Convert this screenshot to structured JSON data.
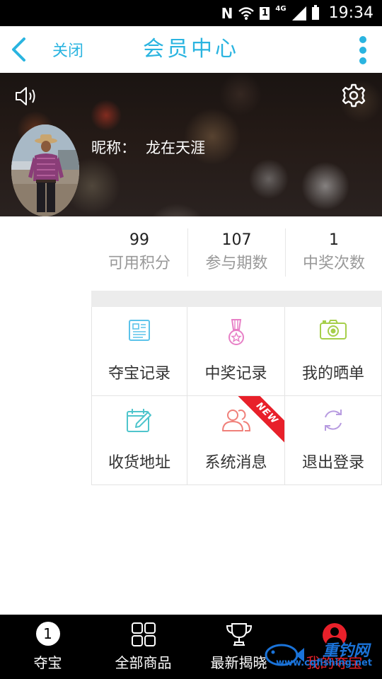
{
  "status_bar": {
    "time": "19:34",
    "network": "4G",
    "sim_slot": "1"
  },
  "header": {
    "back_label": "关闭",
    "title": "会员中心"
  },
  "profile": {
    "nickname_label": "昵称：",
    "nickname": "龙在天涯"
  },
  "stats": [
    {
      "value": "99",
      "label": "可用积分"
    },
    {
      "value": "107",
      "label": "参与期数"
    },
    {
      "value": "1",
      "label": "中奖次数"
    }
  ],
  "menu": [
    {
      "label": "夺宝记录",
      "icon": "document-icon",
      "color": "#5cc3ea"
    },
    {
      "label": "中奖记录",
      "icon": "medal-icon",
      "color": "#e77fc6"
    },
    {
      "label": "我的晒单",
      "icon": "camera-icon",
      "color": "#a6cf4a"
    },
    {
      "label": "收货地址",
      "icon": "calendar-edit-icon",
      "color": "#4fc5cc"
    },
    {
      "label": "系统消息",
      "icon": "users-icon",
      "color": "#f0807a",
      "badge": "NEW"
    },
    {
      "label": "退出登录",
      "icon": "refresh-icon",
      "color": "#b79be0"
    }
  ],
  "bottom_nav": [
    {
      "label": "夺宝",
      "icon": "numbered-circle-icon",
      "icon_text": "1"
    },
    {
      "label": "全部商品",
      "icon": "grid-icon"
    },
    {
      "label": "最新揭晓",
      "icon": "trophy-icon"
    },
    {
      "label": "我的夺宝",
      "icon": "user-icon",
      "active": true
    }
  ],
  "watermark": {
    "name": "重钓网",
    "url": "www.cqfishing.net"
  },
  "colors": {
    "accent": "#2ab4e0",
    "active_red": "#e8202a"
  }
}
